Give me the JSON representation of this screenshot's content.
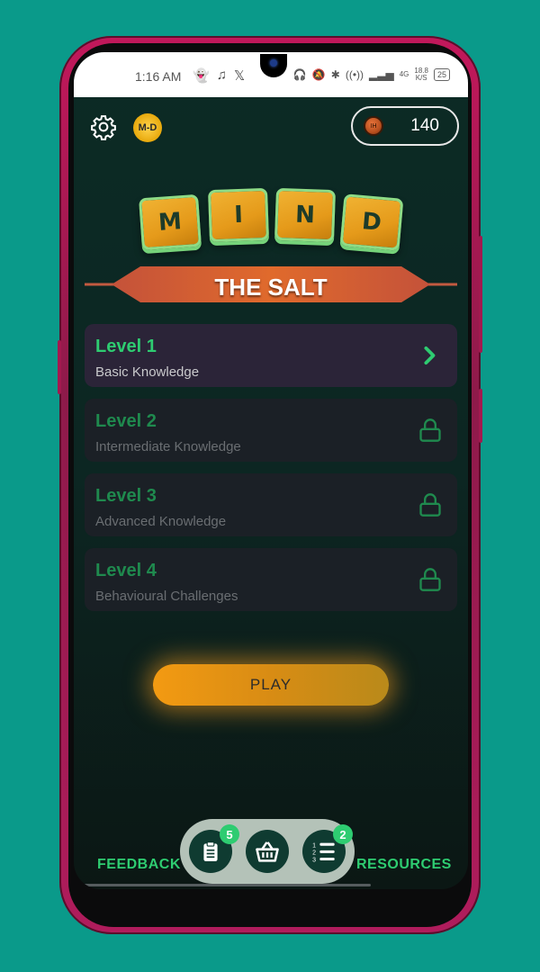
{
  "status_bar": {
    "time": "1:16 AM",
    "network": "4G",
    "net_speed_value": "18.8",
    "net_speed_unit": "K/S",
    "battery": "25",
    "left_icons": [
      "snapchat-icon",
      "tiktok-icon",
      "x-icon"
    ],
    "right_icons": [
      "headphones-icon",
      "mute-icon",
      "bluetooth-icon",
      "hotspot-icon",
      "signal-icon"
    ]
  },
  "header": {
    "coins": "140",
    "coin_label": "IH",
    "logo_text": "M-D"
  },
  "title": {
    "tiles": [
      "M",
      "I",
      "N",
      "D"
    ],
    "ribbon": "THE SALT"
  },
  "levels": [
    {
      "title": "Level 1",
      "subtitle": "Basic Knowledge",
      "state": "unlocked",
      "icon": "chevron-right-icon"
    },
    {
      "title": "Level 2",
      "subtitle": "Intermediate Knowledge",
      "state": "locked",
      "icon": "lock-icon"
    },
    {
      "title": "Level 3",
      "subtitle": "Advanced Knowledge",
      "state": "locked",
      "icon": "lock-icon"
    },
    {
      "title": "Level 4",
      "subtitle": "Behavioural Challenges",
      "state": "locked",
      "icon": "lock-icon"
    }
  ],
  "play_label": "PLAY",
  "footer": {
    "feedback_label": "FEEDBACK",
    "resources_label": "RESOURCES",
    "tasks_badge": "5",
    "shop_icon": "basket-icon",
    "leaderboard_badge": "2"
  },
  "colors": {
    "accent_green": "#2ecc71",
    "play_orange": "#f39a12",
    "background": "#0c2b25",
    "page_bg": "#0a9a8a",
    "phone_frame": "#c2185b"
  }
}
